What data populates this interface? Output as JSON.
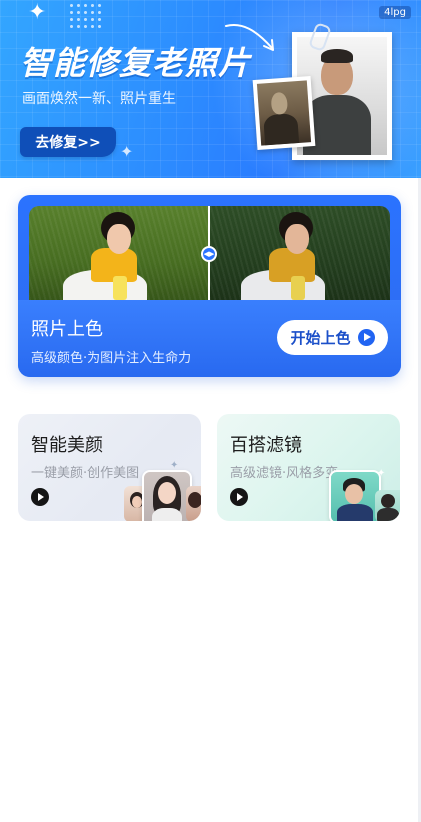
{
  "hero": {
    "title": "智能修复老照片",
    "subtitle": "画面焕然一新、照片重生",
    "button_label": "去修复>>",
    "corner_tag": "4lpg"
  },
  "colorize": {
    "title": "照片上色",
    "subtitle": "高级颜色·为图片注入生命力",
    "button_label": "开始上色"
  },
  "features": [
    {
      "title": "智能美颜",
      "subtitle": "一键美颜·创作美图"
    },
    {
      "title": "百搭滤镜",
      "subtitle": "高级滤镜·风格多变"
    }
  ],
  "colors": {
    "accent": "#2b73ff",
    "hero_button": "#0f4fb8"
  },
  "icons": [
    "sparkle-icon",
    "arrow-icon",
    "play-icon",
    "compare-handle-icon"
  ]
}
